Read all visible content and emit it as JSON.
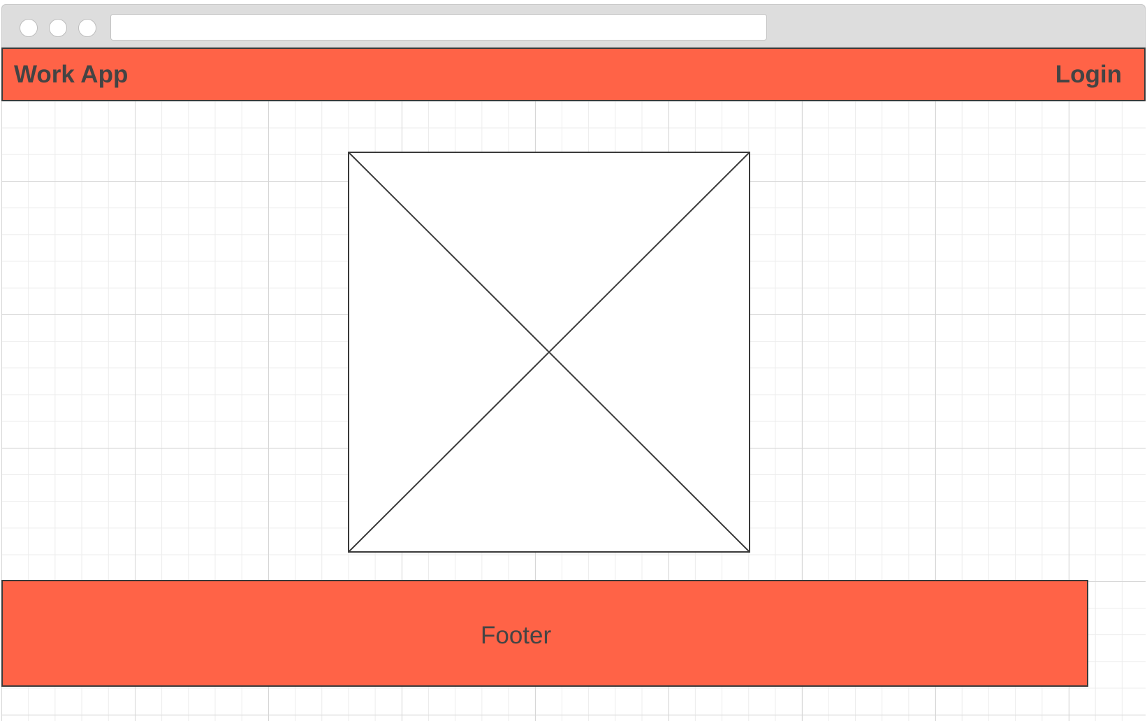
{
  "browser": {
    "address_bar_value": ""
  },
  "navbar": {
    "brand": "Work App",
    "login_label": "Login"
  },
  "footer": {
    "text": "Footer"
  },
  "colors": {
    "brand": "#ff6347",
    "text": "#444444",
    "border": "#3a3a3a",
    "chrome": "#dddddd",
    "grid": "#e6e6e6"
  },
  "icons": {
    "image_placeholder": "image-placeholder-icon"
  }
}
